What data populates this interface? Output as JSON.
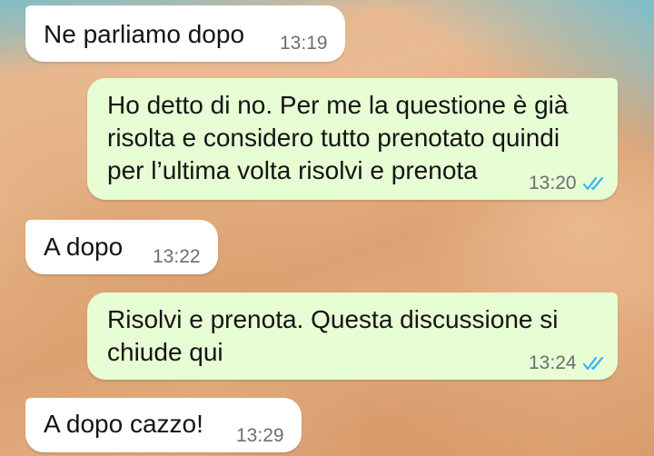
{
  "chat": {
    "messages": [
      {
        "direction": "incoming",
        "text": "Ne parliamo dopo",
        "time": "13:19"
      },
      {
        "direction": "outgoing",
        "text": "Ho detto di no. Per me la questione è già\nrisolta e considero tutto prenotato quindi\nper l’ultima volta risolvi e prenota",
        "time": "13:20",
        "status_icon": "double-check-read-icon"
      },
      {
        "direction": "incoming",
        "text": "A dopo",
        "time": "13:22"
      },
      {
        "direction": "outgoing",
        "text": "Risolvi e prenota. Questa discussione si\nchiude qui",
        "time": "13:24",
        "status_icon": "double-check-read-icon"
      },
      {
        "direction": "incoming",
        "text": "A dopo cazzo!",
        "time": "13:29"
      }
    ]
  },
  "colors": {
    "incoming_bubble": "#ffffff",
    "outgoing_bubble": "#e7fdd4",
    "read_ticks": "#34b7f1",
    "timestamp": "#6a6f72"
  }
}
